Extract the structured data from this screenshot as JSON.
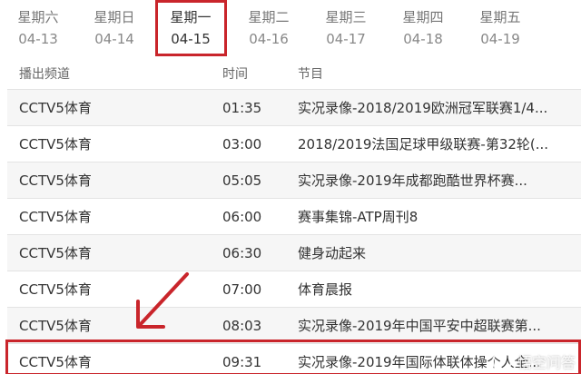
{
  "days": [
    {
      "name": "星期六",
      "date": "04-13"
    },
    {
      "name": "星期日",
      "date": "04-14"
    },
    {
      "name": "星期一",
      "date": "04-15"
    },
    {
      "name": "星期二",
      "date": "04-16"
    },
    {
      "name": "星期三",
      "date": "04-17"
    },
    {
      "name": "星期四",
      "date": "04-18"
    },
    {
      "name": "星期五",
      "date": "04-19"
    }
  ],
  "active_day_index": 2,
  "table": {
    "headers": {
      "channel": "播出频道",
      "time": "时间",
      "program": "节目"
    },
    "rows": [
      {
        "channel": "CCTV5体育",
        "time": "01:35",
        "program": "实况录像-2018/2019欧洲冠军联赛1/4..."
      },
      {
        "channel": "CCTV5体育",
        "time": "03:00",
        "program": "2018/2019法国足球甲级联赛-第32轮(..."
      },
      {
        "channel": "CCTV5体育",
        "time": "05:05",
        "program": "实况录像-2019年成都跑酷世界杯赛..."
      },
      {
        "channel": "CCTV5体育",
        "time": "06:00",
        "program": "赛事集锦-ATP周刊8"
      },
      {
        "channel": "CCTV5体育",
        "time": "06:30",
        "program": "健身动起来"
      },
      {
        "channel": "CCTV5体育",
        "time": "07:00",
        "program": "体育晨报"
      },
      {
        "channel": "CCTV5体育",
        "time": "08:03",
        "program": "实况录像-2019年中国平安中超联赛第..."
      },
      {
        "channel": "CCTV5体育",
        "time": "09:31",
        "program": "实况录像-2019年国际体联体操个人全..."
      }
    ]
  },
  "highlighted_row_index": 7,
  "watermark": {
    "text": "悟空问答"
  },
  "colors": {
    "highlight": "#c9252b",
    "odd_row": "#f6f6f6"
  }
}
